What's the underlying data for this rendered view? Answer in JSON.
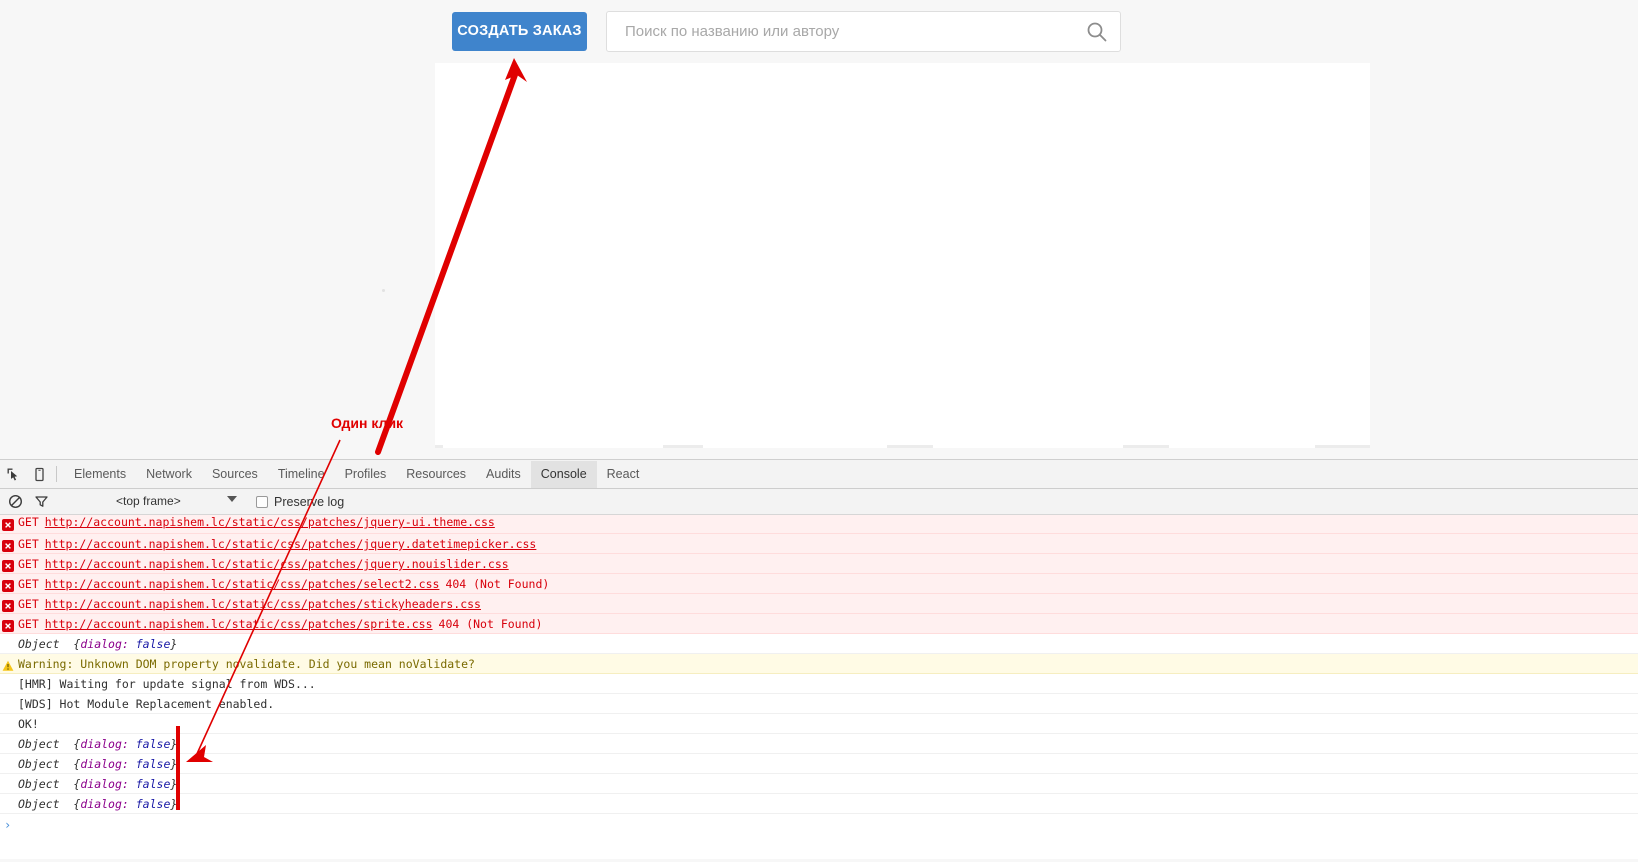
{
  "app": {
    "toolbar": {
      "create_order_label": "СОЗДАТЬ ЗАКАЗ",
      "search_placeholder": "Поиск по названию или автору",
      "search_value": "",
      "search_icon": "search-icon"
    }
  },
  "devtools": {
    "tabs": [
      {
        "label": "Elements",
        "active": false
      },
      {
        "label": "Network",
        "active": false
      },
      {
        "label": "Sources",
        "active": false
      },
      {
        "label": "Timeline",
        "active": false
      },
      {
        "label": "Profiles",
        "active": false
      },
      {
        "label": "Resources",
        "active": false
      },
      {
        "label": "Audits",
        "active": false
      },
      {
        "label": "Console",
        "active": true
      },
      {
        "label": "React",
        "active": false
      }
    ],
    "icons": {
      "inspect": "inspect-element-icon",
      "device": "device-toolbar-icon",
      "clear": "clear-console-icon",
      "filter": "filter-icon"
    },
    "console_filter": {
      "frame_selected": "<top frame>",
      "preserve_log_label": "Preserve log",
      "preserve_log_checked": false
    },
    "console_rows": [
      {
        "kind": "error",
        "badge": "error-icon",
        "method": "GET",
        "url": "http://account.napishem.lc/static/css/patches/jquery-ui.theme.css",
        "status": "",
        "clipped": true
      },
      {
        "kind": "error",
        "badge": "error-icon",
        "method": "GET",
        "url": "http://account.napishem.lc/static/css/patches/jquery.datetimepicker.css",
        "status": ""
      },
      {
        "kind": "error",
        "badge": "error-icon",
        "method": "GET",
        "url": "http://account.napishem.lc/static/css/patches/jquery.nouislider.css",
        "status": ""
      },
      {
        "kind": "error",
        "badge": "error-icon",
        "method": "GET",
        "url": "http://account.napishem.lc/static/css/patches/select2.css",
        "status": "404 (Not Found)"
      },
      {
        "kind": "error",
        "badge": "error-icon",
        "method": "GET",
        "url": "http://account.napishem.lc/static/css/patches/stickyheaders.css",
        "status": ""
      },
      {
        "kind": "error",
        "badge": "error-icon",
        "method": "GET",
        "url": "http://account.napishem.lc/static/css/patches/sprite.css",
        "status": "404 (Not Found)"
      },
      {
        "kind": "object",
        "badge": "",
        "object_word": "Object",
        "object_key": "dialog:",
        "object_value": "false"
      },
      {
        "kind": "warning",
        "badge": "warning-icon",
        "text": "Warning: Unknown DOM property novalidate. Did you mean noValidate?"
      },
      {
        "kind": "log",
        "badge": "",
        "text": "[HMR] Waiting for update signal from WDS..."
      },
      {
        "kind": "log",
        "badge": "",
        "text": "[WDS] Hot Module Replacement enabled."
      },
      {
        "kind": "log",
        "badge": "",
        "text": "OK!"
      },
      {
        "kind": "object",
        "badge": "",
        "object_word": "Object",
        "object_key": "dialog:",
        "object_value": "false"
      },
      {
        "kind": "object",
        "badge": "",
        "object_word": "Object",
        "object_key": "dialog:",
        "object_value": "false"
      },
      {
        "kind": "object",
        "badge": "",
        "object_word": "Object",
        "object_key": "dialog:",
        "object_value": "false"
      },
      {
        "kind": "object",
        "badge": "",
        "object_word": "Object",
        "object_key": "dialog:",
        "object_value": "false"
      }
    ],
    "prompt_caret": "›"
  },
  "annotation": {
    "label": "Один клик",
    "color": "#e00000"
  },
  "colors": {
    "accent_button": "#3f84cc",
    "error_text": "#d8000c",
    "error_row_bg": "#fff0f0",
    "warning_row_bg": "#fffbe5",
    "annotation_red": "#e00000",
    "devtools_chrome": "#f3f3f3"
  }
}
